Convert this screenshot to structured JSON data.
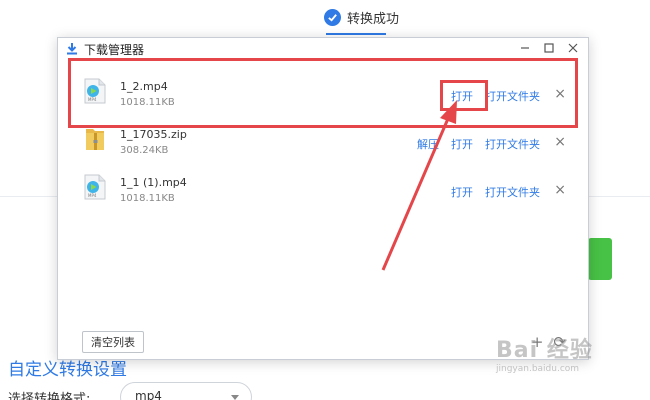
{
  "background": {
    "status_text": "转换成功",
    "custom_settings_label": "自定义转换设置",
    "format_label": "选择转换格式:",
    "format_value": "mp4"
  },
  "download_manager": {
    "title": "下载管理器",
    "items": [
      {
        "name": "1_2.mp4",
        "size": "1018.11KB",
        "type": "video",
        "icon": "video-file-icon",
        "actions": [
          "打开",
          "打开文件夹"
        ]
      },
      {
        "name": "1_17035.zip",
        "size": "308.24KB",
        "type": "zip",
        "icon": "zip-file-icon",
        "actions": [
          "解压",
          "打开",
          "打开文件夹"
        ]
      },
      {
        "name": "1_1 (1).mp4",
        "size": "1018.11KB",
        "type": "video",
        "icon": "video-file-icon",
        "actions": [
          "打开",
          "打开文件夹"
        ]
      }
    ],
    "clear_button": "清空列表"
  },
  "watermark": {
    "brand": "Bai 经验",
    "url": "jingyan.baidu.com"
  },
  "colors": {
    "accent": "#2f7ae5",
    "annotation": "#e5464a",
    "success_green": "#47c146"
  }
}
